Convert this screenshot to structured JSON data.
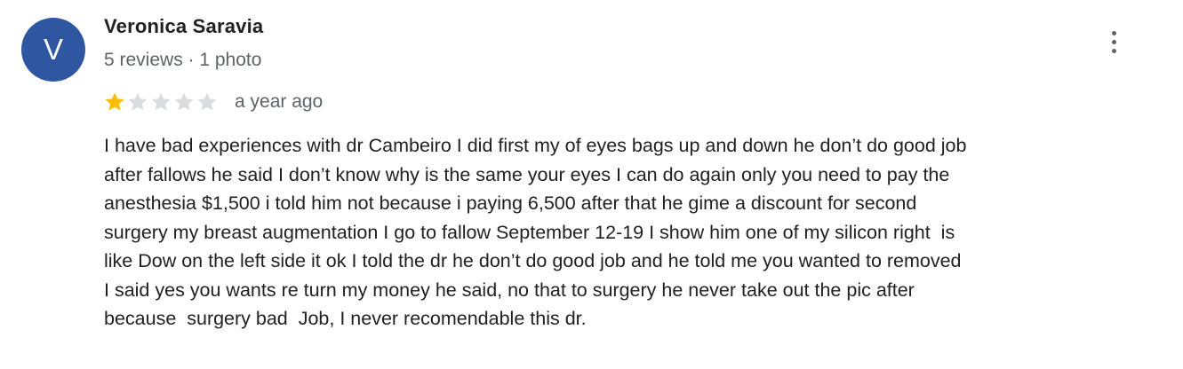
{
  "reviewer": {
    "initial": "V",
    "name": "Veronica Saravia",
    "meta": "5 reviews · 1 photo",
    "avatar_color": "#2f56a0"
  },
  "review": {
    "rating": 1,
    "max_rating": 5,
    "star_filled_color": "#fbbc04",
    "star_empty_color": "#dadce0",
    "date": "a year ago",
    "text_lines": [
      "I have bad experiences with dr Cambeiro I did first my of eyes bags up and down he don’t do good job",
      "after fallows he said I don’t know why is the same your eyes I can do again only you need to pay the",
      "anesthesia $1,500 i told him not because i paying 6,500 after that he gime a discount for second",
      "surgery my breast augmentation I go to fallow September 12-19 I show him one of my silicon right  is",
      "like Dow on the left side it ok I told the dr he don’t do good job and he told me you wanted to removed",
      "I said yes you wants re turn my money he said, no that to surgery he never take out the pic after",
      "because  surgery bad  Job, I never recomendable this dr."
    ]
  },
  "menu": {
    "icon": "more-vert-icon"
  }
}
